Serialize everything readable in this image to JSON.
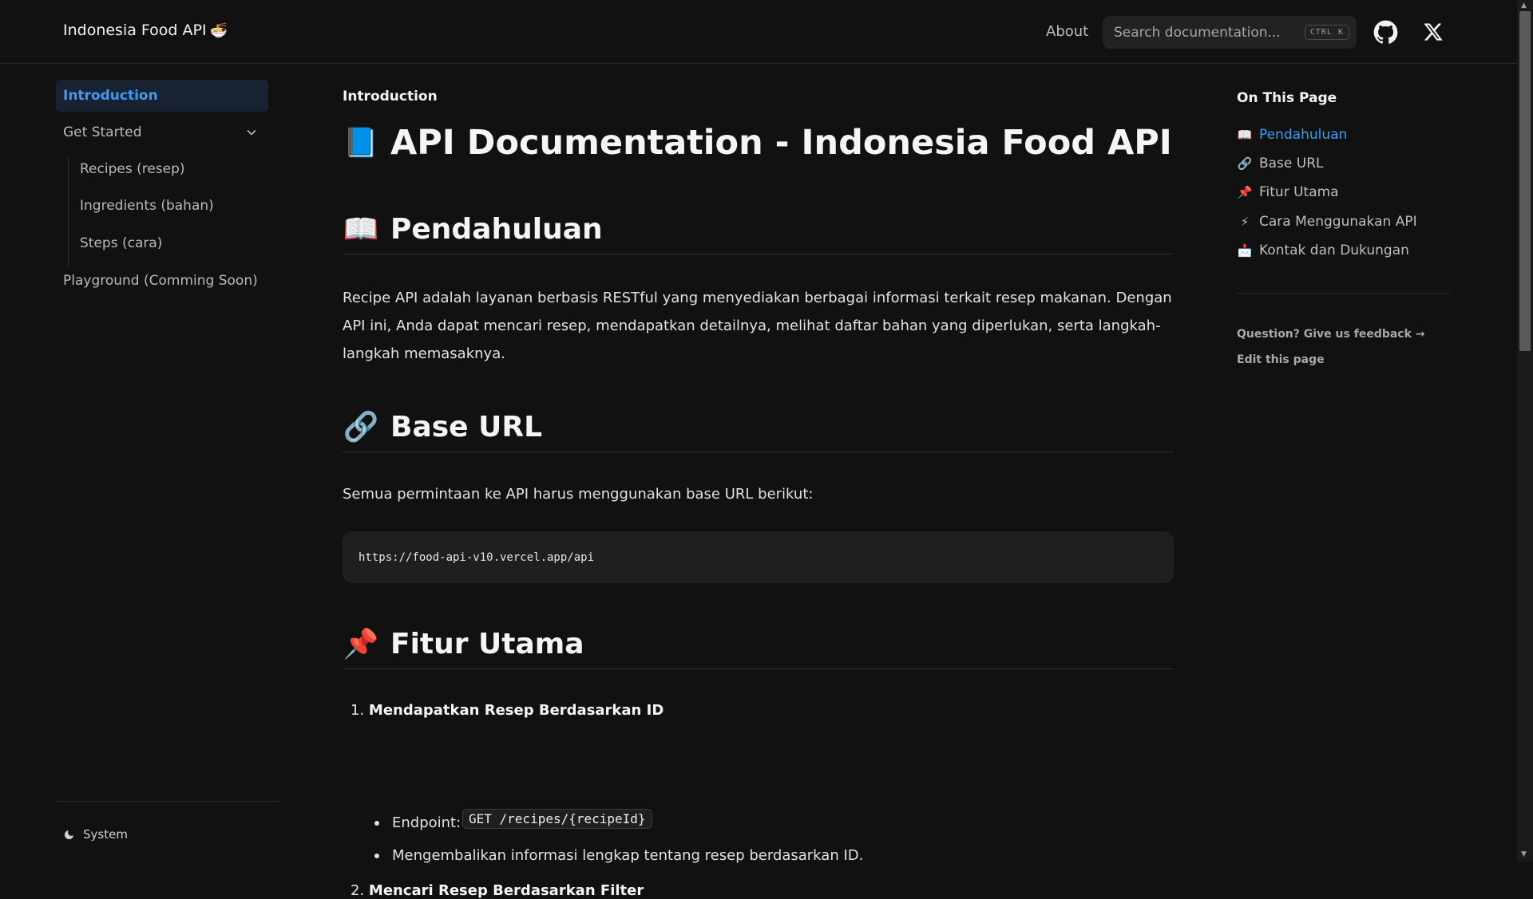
{
  "header": {
    "brand": "Indonesia Food API",
    "brand_icon": "bowl-emoji",
    "about_label": "About",
    "search_placeholder": "Search documentation...",
    "search_shortcut": "CTRL K",
    "github_icon": "github-icon",
    "x_icon": "x-icon"
  },
  "sidebar": {
    "items": [
      {
        "label": "Introduction",
        "active": true
      },
      {
        "label": "Get Started",
        "expanded": true
      },
      {
        "label": "Recipes (resep)"
      },
      {
        "label": "Ingredients (bahan)"
      },
      {
        "label": "Steps (cara)"
      },
      {
        "label": "Playground (Comming Soon)"
      }
    ],
    "theme_label": "System"
  },
  "main": {
    "breadcrumb": "Introduction",
    "title": "API Documentation - Indonesia Food API",
    "title_emoji": "📘",
    "sections": [
      {
        "emoji": "📖",
        "heading": "Pendahuluan"
      },
      {
        "emoji": "🔗",
        "heading": "Base URL"
      },
      {
        "emoji": "📌",
        "heading": "Fitur Utama"
      }
    ],
    "intro_text": "Recipe API adalah layanan berbasis RESTful yang menyediakan berbagai informasi terkait resep makanan. Dengan API ini, Anda dapat mencari resep, mendapatkan detailnya, melihat daftar bahan yang diperlukan, serta langkah-langkah memasaknya.",
    "base_url_text": "Semua permintaan ke API harus menggunakan base URL berikut:",
    "base_url": "https://food-api-v10.vercel.app/api",
    "features": [
      {
        "number": "1.",
        "title": "Mendapatkan Resep Berdasarkan ID",
        "endpoint_label": "Endpoint:",
        "endpoint": "GET /recipes/{recipeId}",
        "description": "Mengembalikan informasi lengkap tentang resep berdasarkan ID."
      },
      {
        "number": "2.",
        "title": "Mencari Resep Berdasarkan Filter"
      }
    ]
  },
  "toc": {
    "title": "On This Page",
    "items": [
      {
        "emoji": "📖",
        "label": "Pendahuluan",
        "active": true
      },
      {
        "emoji": "🔗",
        "label": "Base URL"
      },
      {
        "emoji": "📌",
        "label": "Fitur Utama"
      },
      {
        "emoji": "⚡",
        "label": "Cara Menggunakan API"
      },
      {
        "emoji": "📩",
        "label": "Kontak dan Dukungan"
      }
    ],
    "feedback_label": "Question? Give us feedback →",
    "edit_label": "Edit this page"
  },
  "colors": {
    "background": "#111111",
    "accent": "#3b9bf5",
    "active_bg": "#182230"
  }
}
